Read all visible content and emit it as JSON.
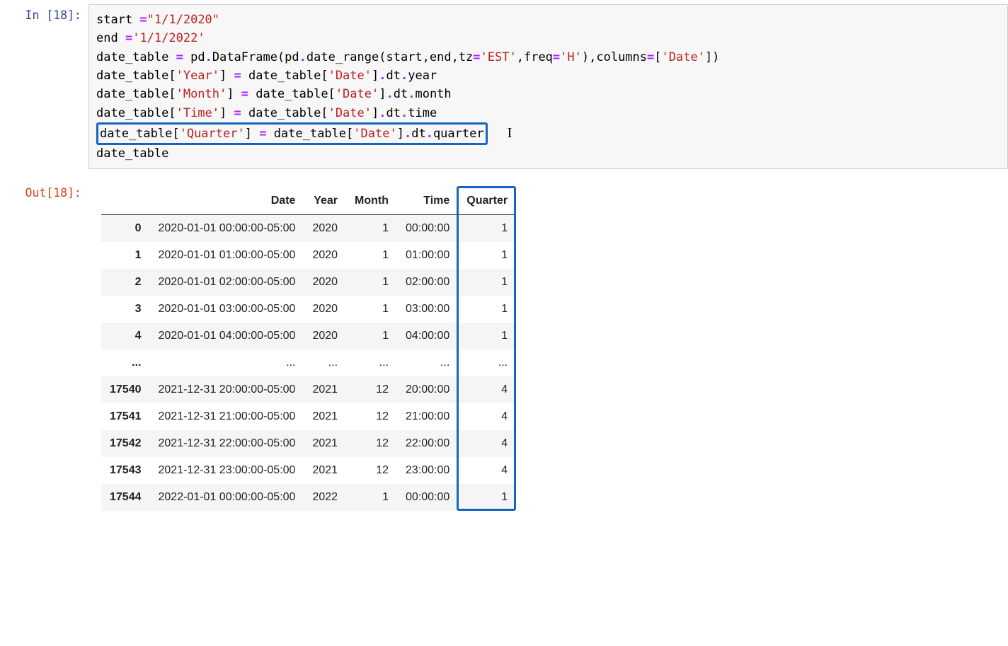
{
  "cell": {
    "in_prompt": "In [18]:",
    "out_prompt": "Out[18]:",
    "code": {
      "line1_a": "start ",
      "line1_eq": "=",
      "line1_str": "\"1/1/2020\"",
      "line2_a": "end ",
      "line2_eq": "=",
      "line2_str": "'1/1/2022'",
      "line3_a": "date_table ",
      "line3_eq": "=",
      "line3_b": " pd",
      "line3_dot1": ".",
      "line3_c": "DataFrame(pd",
      "line3_dot2": ".",
      "line3_d": "date_range(start,end,tz",
      "line3_eq2": "=",
      "line3_str1": "'EST'",
      "line3_e": ",freq",
      "line3_eq3": "=",
      "line3_str2": "'H'",
      "line3_f": "),columns",
      "line3_eq4": "=",
      "line3_g": "[",
      "line3_str3": "'Date'",
      "line3_h": "])",
      "line4_a": "date_table[",
      "line4_str1": "'Year'",
      "line4_b": "] ",
      "line4_eq": "=",
      "line4_c": " date_table[",
      "line4_str2": "'Date'",
      "line4_d": "]",
      "line4_dot": ".",
      "line4_e": "dt",
      "line4_dot2": ".",
      "line4_f": "year",
      "line5_a": "date_table[",
      "line5_str1": "'Month'",
      "line5_b": "] ",
      "line5_eq": "=",
      "line5_c": " date_table[",
      "line5_str2": "'Date'",
      "line5_d": "]",
      "line5_dot": ".",
      "line5_e": "dt",
      "line5_dot2": ".",
      "line5_f": "month",
      "line6_a": "date_table[",
      "line6_str1": "'Time'",
      "line6_b": "] ",
      "line6_eq": "=",
      "line6_c": " date_table[",
      "line6_str2": "'Date'",
      "line6_d": "]",
      "line6_dot": ".",
      "line6_e": "dt",
      "line6_dot2": ".",
      "line6_f": "time",
      "line7_a": "date_table[",
      "line7_str1": "'Quarter'",
      "line7_b": "] ",
      "line7_eq": "=",
      "line7_c": " date_table[",
      "line7_str2": "'Date'",
      "line7_d": "]",
      "line7_dot": ".",
      "line7_e": "dt",
      "line7_dot2": ".",
      "line7_f": "quarter",
      "line8": "date_table"
    }
  },
  "table": {
    "columns": [
      "",
      "Date",
      "Year",
      "Month",
      "Time",
      "Quarter"
    ],
    "rows": [
      {
        "idx": "0",
        "date": "2020-01-01 00:00:00-05:00",
        "year": "2020",
        "month": "1",
        "time": "00:00:00",
        "quarter": "1"
      },
      {
        "idx": "1",
        "date": "2020-01-01 01:00:00-05:00",
        "year": "2020",
        "month": "1",
        "time": "01:00:00",
        "quarter": "1"
      },
      {
        "idx": "2",
        "date": "2020-01-01 02:00:00-05:00",
        "year": "2020",
        "month": "1",
        "time": "02:00:00",
        "quarter": "1"
      },
      {
        "idx": "3",
        "date": "2020-01-01 03:00:00-05:00",
        "year": "2020",
        "month": "1",
        "time": "03:00:00",
        "quarter": "1"
      },
      {
        "idx": "4",
        "date": "2020-01-01 04:00:00-05:00",
        "year": "2020",
        "month": "1",
        "time": "04:00:00",
        "quarter": "1"
      },
      {
        "idx": "...",
        "date": "...",
        "year": "...",
        "month": "...",
        "time": "...",
        "quarter": "..."
      },
      {
        "idx": "17540",
        "date": "2021-12-31 20:00:00-05:00",
        "year": "2021",
        "month": "12",
        "time": "20:00:00",
        "quarter": "4"
      },
      {
        "idx": "17541",
        "date": "2021-12-31 21:00:00-05:00",
        "year": "2021",
        "month": "12",
        "time": "21:00:00",
        "quarter": "4"
      },
      {
        "idx": "17542",
        "date": "2021-12-31 22:00:00-05:00",
        "year": "2021",
        "month": "12",
        "time": "22:00:00",
        "quarter": "4"
      },
      {
        "idx": "17543",
        "date": "2021-12-31 23:00:00-05:00",
        "year": "2021",
        "month": "12",
        "time": "23:00:00",
        "quarter": "4"
      },
      {
        "idx": "17544",
        "date": "2022-01-01 00:00:00-05:00",
        "year": "2022",
        "month": "1",
        "time": "00:00:00",
        "quarter": "1"
      }
    ]
  }
}
